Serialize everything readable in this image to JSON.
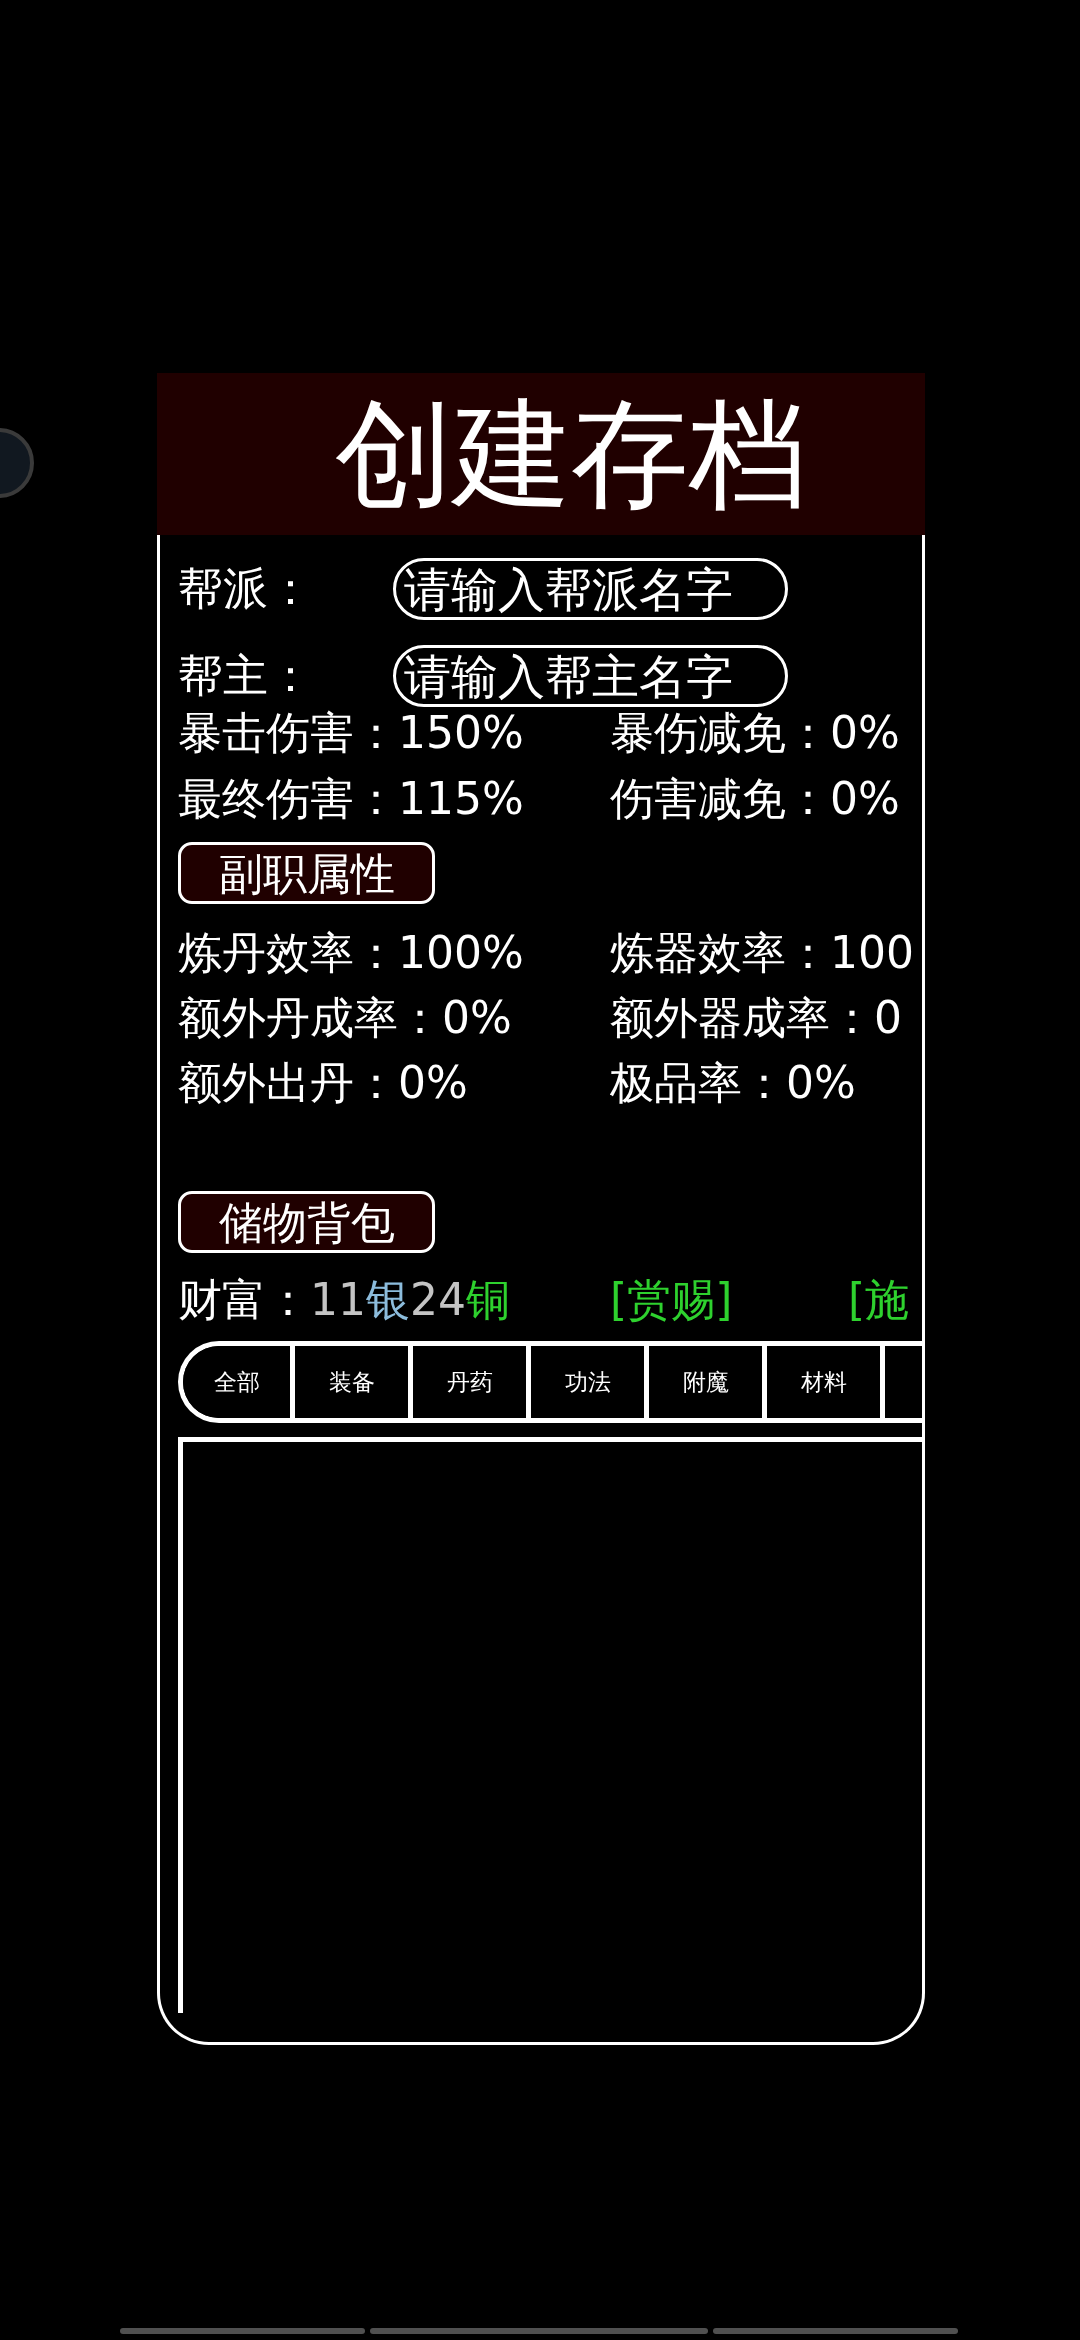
{
  "dialog": {
    "title": "创建存档"
  },
  "fields": [
    {
      "label": "帮派：",
      "placeholder": "请输入帮派名字"
    },
    {
      "label": "帮主：",
      "placeholder": "请输入帮主名字"
    }
  ],
  "combat_stats": [
    [
      "暴击伤害：150%",
      "暴伤减免：0%"
    ],
    [
      "最终伤害：115%",
      "伤害减免：0%"
    ]
  ],
  "profession_button": "副职属性",
  "profession_stats": [
    [
      "炼丹效率：100%",
      "炼器效率：100"
    ],
    [
      "额外丹成率：0%",
      "额外器成率：0"
    ],
    [
      "额外出丹：0%",
      "极品率：0%"
    ]
  ],
  "backpack_button": "储物背包",
  "wealth": {
    "label": "财富：",
    "parts": [
      {
        "text": "11",
        "color": "#c4c4c4"
      },
      {
        "text": "银",
        "color": "#8cbcdc"
      },
      {
        "text": "24",
        "color": "#c4c4c4"
      },
      {
        "text": "铜",
        "color": "#2ed12e"
      }
    ],
    "links": [
      "[赏赐]",
      "[施"
    ]
  },
  "tabs": [
    "全部",
    "装备",
    "丹药",
    "功法",
    "附魔",
    "材料"
  ]
}
